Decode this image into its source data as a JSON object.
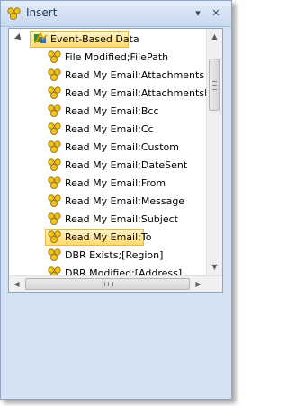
{
  "window": {
    "title": "Insert",
    "dropdown_glyph": "▾",
    "close_glyph": "✕"
  },
  "tree": {
    "root": {
      "label": "Event-Based Data",
      "icon": "event-data-icon"
    },
    "items": [
      {
        "label": "File Modified;FilePath",
        "icon": "puzzle-icon"
      },
      {
        "label": "Read My Email;Attachments",
        "icon": "puzzle-icon"
      },
      {
        "label": "Read My Email;AttachmentsPath",
        "icon": "puzzle-icon"
      },
      {
        "label": "Read My Email;Bcc",
        "icon": "puzzle-icon"
      },
      {
        "label": "Read My Email;Cc",
        "icon": "puzzle-icon"
      },
      {
        "label": "Read My Email;Custom",
        "icon": "puzzle-icon"
      },
      {
        "label": "Read My Email;DateSent",
        "icon": "puzzle-icon"
      },
      {
        "label": "Read My Email;From",
        "icon": "puzzle-icon"
      },
      {
        "label": "Read My Email;Message",
        "icon": "puzzle-icon"
      },
      {
        "label": "Read My Email;Subject",
        "icon": "puzzle-icon"
      },
      {
        "label": "Read My Email;To",
        "icon": "puzzle-icon",
        "selected": true
      },
      {
        "label": "DBR Exists;[Region]",
        "icon": "puzzle-icon"
      },
      {
        "label": "DBR Modified;[Address]",
        "icon": "puzzle-icon"
      }
    ]
  },
  "scrollbars": {
    "up_glyph": "▲",
    "down_glyph": "▼",
    "left_glyph": "◀",
    "right_glyph": "▶"
  },
  "colors": {
    "selection": "#ffd96a",
    "window_bg": "#d5e2f3",
    "title_text": "#1e395b"
  }
}
